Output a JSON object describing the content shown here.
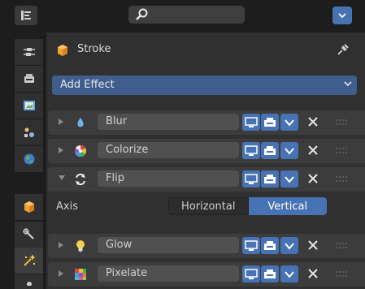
{
  "header": {
    "search_placeholder": "",
    "editor_icon": "outliner-icon",
    "search_icon": "magnifier-icon",
    "options_icon": "chevron-down-icon",
    "accent": "#4772b3"
  },
  "tabs": [
    {
      "icon": "tool-icon"
    },
    {
      "icon": "render-icon"
    },
    {
      "icon": "output-icon"
    },
    {
      "icon": "view-layer-icon"
    },
    {
      "icon": "scene-icon"
    },
    {
      "icon": "world-icon"
    },
    {
      "icon": "object-icon"
    },
    {
      "icon": "modifier-wrench-icon"
    },
    {
      "icon": "shader-fx-icon",
      "active": true
    }
  ],
  "context": {
    "object_name": "Stroke",
    "object_icon": "object-cube-icon",
    "pin_icon": "pin-icon"
  },
  "add_effect": {
    "label": "Add Effect"
  },
  "effects": [
    {
      "name": "Blur",
      "icon": "blur-drop-icon",
      "expanded": false
    },
    {
      "name": "Colorize",
      "icon": "colorize-icon",
      "expanded": false
    },
    {
      "name": "Flip",
      "icon": "flip-icon",
      "expanded": true
    },
    {
      "name": "Glow",
      "icon": "glow-bulb-icon",
      "expanded": false
    },
    {
      "name": "Pixelate",
      "icon": "pixelate-icon",
      "expanded": false
    }
  ],
  "flip_settings": {
    "axis_label": "Axis",
    "options": [
      "Horizontal",
      "Vertical"
    ],
    "selected": "Vertical"
  }
}
